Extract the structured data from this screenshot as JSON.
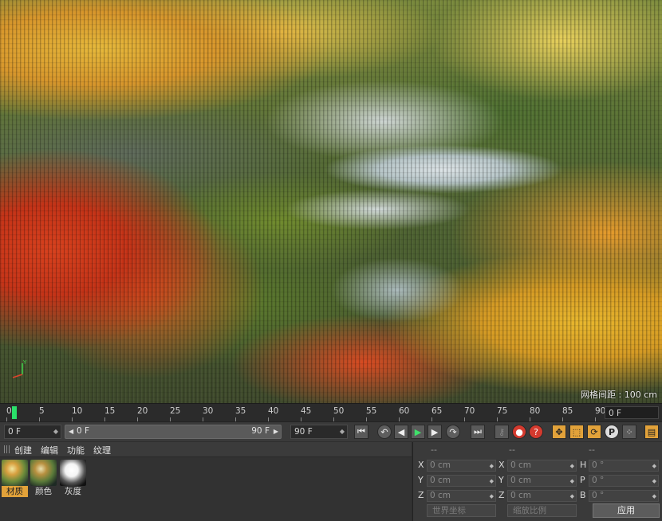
{
  "viewport": {
    "grid_spacing": "网格间距 : 100 cm"
  },
  "timeline": {
    "ticks": [
      "0",
      "5",
      "10",
      "15",
      "20",
      "25",
      "30",
      "35",
      "40",
      "45",
      "50",
      "55",
      "60",
      "65",
      "70",
      "75",
      "80",
      "85",
      "90"
    ],
    "current_frame": "0 F"
  },
  "transport": {
    "start_field": "0 F",
    "range_start": "0 F",
    "range_end": "90 F",
    "end_field": "90 F"
  },
  "material_manager": {
    "menu": [
      "创建",
      "编辑",
      "功能",
      "纹理"
    ],
    "materials": [
      {
        "label": "材质",
        "selected": true
      },
      {
        "label": "颜色",
        "selected": false
      },
      {
        "label": "灰度",
        "selected": false
      }
    ]
  },
  "coordinates": {
    "headers": [
      "--",
      "--",
      "--"
    ],
    "pos": [
      {
        "axis": "X",
        "value": "0 cm"
      },
      {
        "axis": "Y",
        "value": "0 cm"
      },
      {
        "axis": "Z",
        "value": "0 cm"
      }
    ],
    "size": [
      {
        "axis": "X",
        "value": "0 cm"
      },
      {
        "axis": "Y",
        "value": "0 cm"
      },
      {
        "axis": "Z",
        "value": "0 cm"
      }
    ],
    "rot": [
      {
        "axis": "H",
        "value": "0 °"
      },
      {
        "axis": "P",
        "value": "0 °"
      },
      {
        "axis": "B",
        "value": "0 °"
      }
    ],
    "mode_dropdown": "世界坐标",
    "scale_dropdown": "缩放比例",
    "apply_label": "应用"
  },
  "colors": {
    "playhead": "#2ae06a",
    "accent_orange": "#e2a23a",
    "record_red": "#d43a2e"
  }
}
